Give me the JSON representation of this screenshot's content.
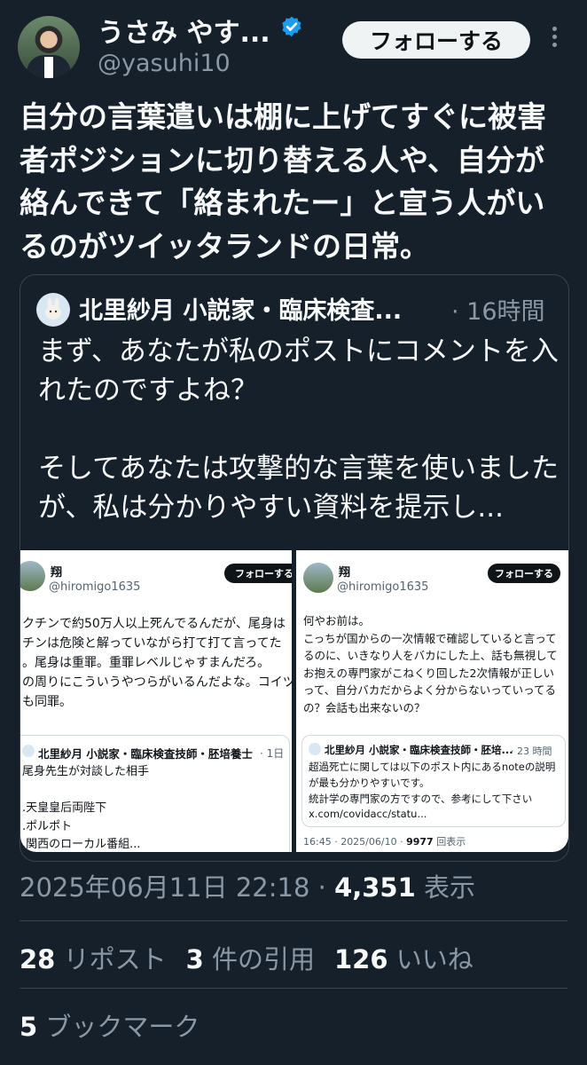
{
  "author": {
    "display_name": "うさみ やす...",
    "handle": "@yasuhi10",
    "follow_label": "フォローする"
  },
  "tweet": {
    "text": "自分の言葉遣いは棚に上げてすぐに被害者ポジションに切り替える人や、自分が絡んできて「絡まれたー」と宣う人がいるのがツイッタランドの日常。"
  },
  "quote": {
    "display_name": "北里紗月 小説家・臨床検査...",
    "time": "· 16時間",
    "text_lines": [
      "まず、あなたが私のポストにコメントを入れたのですよね？",
      "そしてあなたは攻撃的な言葉を使いましたが、私は分かりやすい資料を提示し..."
    ],
    "images": [
      {
        "name": "翔",
        "handle": "@hiromigo1635",
        "follow_label": "フォローする",
        "lines": [
          "クチンで約50万人以上死んでるんだが、尾身は",
          "チンは危険と解っていながら打て打て言ってた",
          "。尾身は重罪。重罪レベルじゃすまんだろ。",
          "の周りにこういうやつらがいるんだよな。コイツ",
          "も同罪。"
        ],
        "quoted_name": "北里紗月 小説家・臨床検査技師・胚培養士",
        "quoted_time": "· 1日",
        "quoted_lines": [
          "尾身先生が対談した相手",
          "",
          ".天皇皇后両陛下",
          ".ポルポト",
          ".関西のローカル番組..."
        ]
      },
      {
        "name": "翔",
        "handle": "@hiromigo1635",
        "follow_label": "フォローする",
        "lines": [
          "何やお前は。",
          "こっちが国からの一次情報で確認していると言って",
          "るのに、いきなり人をバカにした上、話も無視して",
          "お抱えの専門家がこねくり回した2次情報が正しい",
          "って、自分バカだからよく分からないっていってる",
          "の？会話も出来ないの？"
        ],
        "quoted_name": "北里紗月 小説家・臨床検査技師・胚培...",
        "quoted_time": "· 23 時間",
        "quoted_lines": [
          "超過死亡に関しては以下のポスト内にあるnoteの説明",
          "が最も分かりやすいです。",
          "統計学の専門家の方ですので、参考にして下さい",
          "x.com/covidacc/statu..."
        ],
        "meta_time": "16:45 · 2025/06/10 · ",
        "meta_views": "9977",
        "meta_views_label": " 回表示"
      }
    ]
  },
  "footer": {
    "timestamp": "2025年06月11日 22:18 · ",
    "views": "4,351",
    "views_label": " 表示",
    "reposts_count": "28",
    "reposts_label": " リポスト",
    "quotes_count": "3",
    "quotes_label": " 件の引用",
    "likes_count": "126",
    "likes_label": " いいね",
    "bookmarks_count": "5",
    "bookmarks_label": " ブックマーク"
  },
  "colors": {
    "background": "#15202b",
    "text": "#f7f9f9",
    "muted": "#8b98a5",
    "verified": "#1d9bf0",
    "divider": "#38444d"
  }
}
